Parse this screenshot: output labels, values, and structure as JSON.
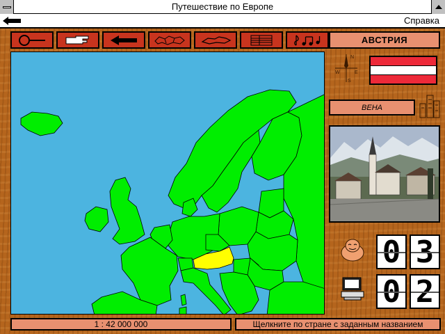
{
  "window": {
    "title": "Путешествие по Европе"
  },
  "menu": {
    "back_icon": "back-arrow-icon",
    "help": "Справка"
  },
  "toolbar": {
    "buttons": [
      {
        "icon": "zoom-circle-icon"
      },
      {
        "icon": "pointing-hand-icon"
      },
      {
        "icon": "left-arrow-icon"
      },
      {
        "icon": "map-outline-icon"
      },
      {
        "icon": "country-shape-icon"
      },
      {
        "icon": "list-lines-icon"
      },
      {
        "icon": "music-notes-icon"
      }
    ]
  },
  "info": {
    "country": "АВСТРИЯ",
    "capital": "ВЕНА",
    "flag_colors": [
      "#ed2939",
      "#ffffff",
      "#ed2939"
    ]
  },
  "counters": {
    "correct": [
      "0",
      "3"
    ],
    "computer": [
      "0",
      "2"
    ]
  },
  "status": {
    "scale": "1 : 42 000 000",
    "message": "Щелкните по стране с заданным названием"
  },
  "colors": {
    "sea": "#4cb4e0",
    "land": "#00ee00",
    "highlight": "#ffff00",
    "panel": "#e89070",
    "button": "#c8341e",
    "wood": "#b5651d"
  }
}
